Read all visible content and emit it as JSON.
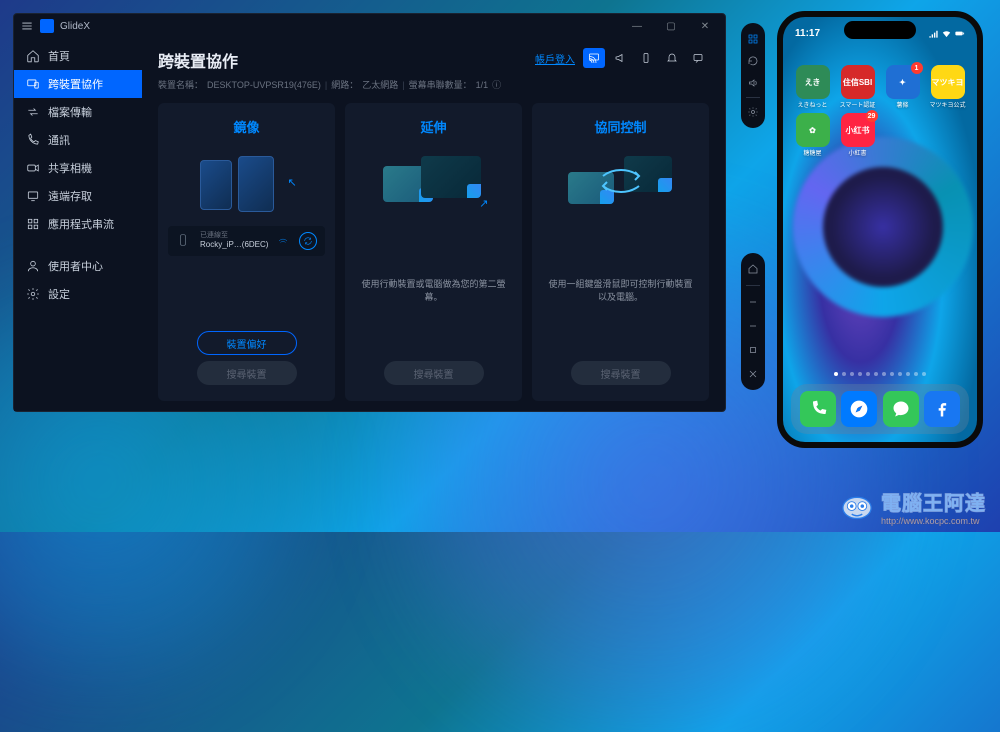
{
  "window": {
    "title": "GlideX"
  },
  "sidebar": {
    "items": [
      {
        "label": "首頁"
      },
      {
        "label": "跨裝置協作"
      },
      {
        "label": "檔案傳輸"
      },
      {
        "label": "通訊"
      },
      {
        "label": "共享相機"
      },
      {
        "label": "遠端存取"
      },
      {
        "label": "應用程式串流"
      }
    ],
    "footer": [
      {
        "label": "使用者中心"
      },
      {
        "label": "設定"
      }
    ]
  },
  "header": {
    "title": "跨裝置協作",
    "link": "帳戶登入",
    "info": {
      "device_label": "裝置名稱：",
      "device": "DESKTOP-UVPSR19(476E)",
      "network_label": "網路：",
      "network": "乙太網路",
      "screen_label": "螢幕串聯數量：",
      "screen": "1/1"
    }
  },
  "cards": {
    "mirror": {
      "title": "鏡像",
      "device_chip": {
        "label": "已連線至",
        "name": "Rocky_iP…(6DEC)"
      },
      "btn_primary": "裝置偏好",
      "btn_secondary": "搜尋裝置"
    },
    "extend": {
      "title": "延伸",
      "desc": "使用行動裝置或電腦做為您的第二螢幕。",
      "btn_secondary": "搜尋裝置"
    },
    "unify": {
      "title": "協同控制",
      "desc": "使用一組鍵盤滑鼠即可控制行動裝置以及電腦。",
      "btn_secondary": "搜尋裝置"
    }
  },
  "phone": {
    "time": "11:17",
    "apps_row1": [
      {
        "label": "えきねっと",
        "bg": "#2e8b57",
        "txt": "えき"
      },
      {
        "label": "スマート認証",
        "bg": "#d62929",
        "txt": "住信SBI"
      },
      {
        "label": "薯條",
        "bg": "#1f6fd4",
        "txt": "✦",
        "badge": "1"
      },
      {
        "label": "マツキヨ公式",
        "bg": "#ffd814",
        "txt": "マツキヨ"
      }
    ],
    "apps_row2": [
      {
        "label": "糖糖屋",
        "bg": "#3cb04a",
        "txt": "✿"
      },
      {
        "label": "小紅書",
        "bg": "#ff2442",
        "txt": "小红书",
        "badge": "29"
      }
    ],
    "dock": [
      {
        "bg": "#34c759",
        "name": "phone"
      },
      {
        "bg": "#007aff",
        "name": "safari"
      },
      {
        "bg": "#34c759",
        "name": "messages"
      },
      {
        "bg": "#1877f2",
        "name": "facebook"
      }
    ]
  },
  "watermark": {
    "title": "電腦王阿達",
    "url": "http://www.kocpc.com.tw"
  }
}
